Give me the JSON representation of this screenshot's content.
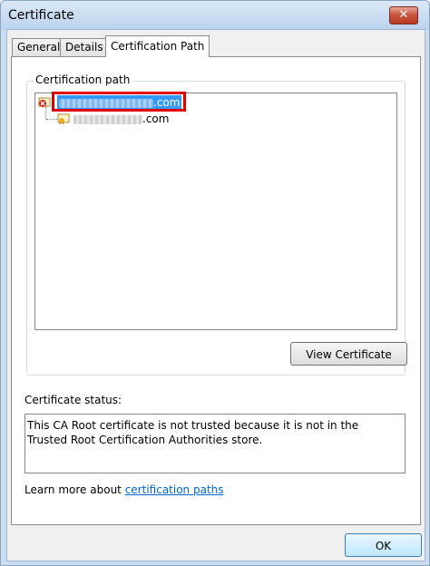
{
  "window": {
    "title": "Certificate",
    "close_glyph": "✕"
  },
  "tabs": [
    {
      "label": "General",
      "active": false
    },
    {
      "label": "Details",
      "active": false
    },
    {
      "label": "Certification Path",
      "active": true
    }
  ],
  "certification_path": {
    "group_label": "Certification path",
    "nodes": [
      {
        "text_suffix": ".com",
        "selected": true,
        "icon": "certificate-error-icon"
      },
      {
        "text_suffix": ".com",
        "selected": false,
        "icon": "certificate-icon"
      }
    ],
    "view_button": "View Certificate"
  },
  "status": {
    "label": "Certificate status:",
    "text": "This CA Root certificate is not trusted because it is not in the Trusted Root Certification Authorities store."
  },
  "learn_more": {
    "prefix": "Learn more about ",
    "link": "certification paths"
  },
  "footer": {
    "ok_button": "OK"
  },
  "colors": {
    "selection": "#3399ff",
    "highlight_border": "#e00000",
    "link": "#0066cc"
  }
}
